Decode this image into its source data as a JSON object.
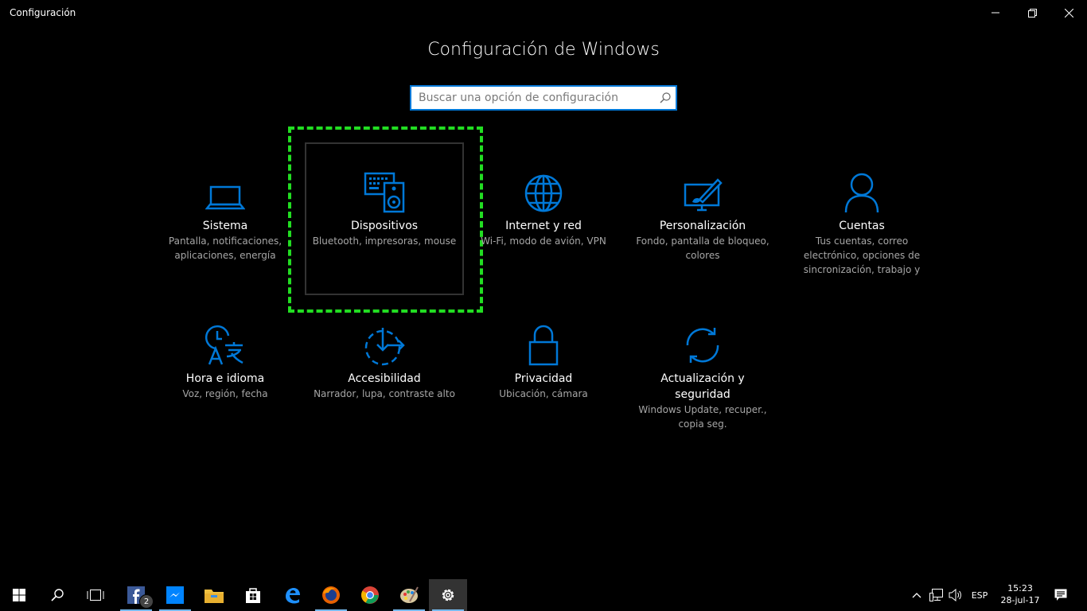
{
  "window": {
    "title": "Configuración"
  },
  "heading": "Configuración de Windows",
  "search": {
    "placeholder": "Buscar una opción de configuración",
    "value": ""
  },
  "tiles": [
    {
      "name": "Sistema",
      "desc": "Pantalla, notificaciones, aplicaciones, energía",
      "icon": "laptop-icon"
    },
    {
      "name": "Dispositivos",
      "desc": "Bluetooth, impresoras, mouse",
      "icon": "devices-icon"
    },
    {
      "name": "Internet y red",
      "desc": "Wi-Fi, modo de avión, VPN",
      "icon": "globe-icon"
    },
    {
      "name": "Personalización",
      "desc": "Fondo, pantalla de bloqueo, colores",
      "icon": "paint-icon"
    },
    {
      "name": "Cuentas",
      "desc": "Tus cuentas, correo electrónico, opciones de sincronización, trabajo y",
      "icon": "person-icon"
    },
    {
      "name": "Hora e idioma",
      "desc": "Voz, región, fecha",
      "icon": "time-language-icon"
    },
    {
      "name": "Accesibilidad",
      "desc": "Narrador, lupa, contraste alto",
      "icon": "ease-of-access-icon"
    },
    {
      "name": "Privacidad",
      "desc": "Ubicación, cámara",
      "icon": "lock-icon"
    },
    {
      "name": "Actualización y seguridad",
      "desc": "Windows Update, recuper., copia seg.",
      "icon": "sync-icon"
    }
  ],
  "taskbar": {
    "facebook_badge": "2",
    "language": "ESP",
    "time": "15:23",
    "date": "28-jul-17"
  },
  "colors": {
    "accent": "#0078d7",
    "focus": "#22dd22"
  }
}
